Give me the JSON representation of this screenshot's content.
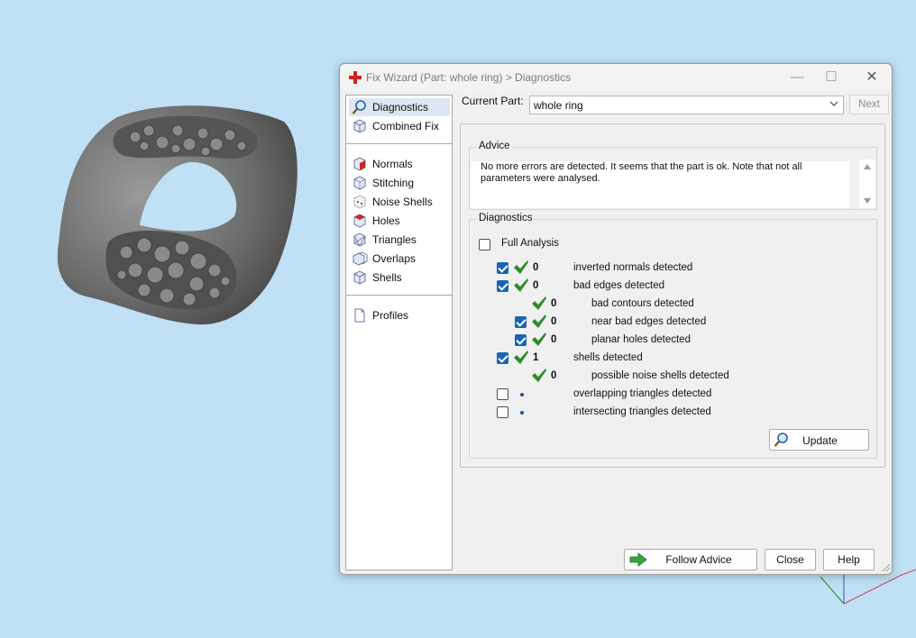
{
  "dialog": {
    "title": "Fix Wizard (Part: whole ring) > Diagnostics",
    "window_controls": {
      "minimize": "—",
      "maximize": "☐",
      "close": "✕"
    }
  },
  "sidebar": {
    "items": [
      {
        "label": "Diagnostics",
        "icon": "magnifier-icon",
        "selected": true
      },
      {
        "label": "Combined Fix",
        "icon": "cube-icon"
      },
      {
        "label": "Normals",
        "icon": "cube-normals-icon"
      },
      {
        "label": "Stitching",
        "icon": "cube-stitching-icon"
      },
      {
        "label": "Noise Shells",
        "icon": "cube-noise-icon"
      },
      {
        "label": "Holes",
        "icon": "cube-holes-icon"
      },
      {
        "label": "Triangles",
        "icon": "cube-triangles-icon"
      },
      {
        "label": "Overlaps",
        "icon": "cube-overlaps-icon"
      },
      {
        "label": "Shells",
        "icon": "cube-shells-icon"
      },
      {
        "label": "Profiles",
        "icon": "document-icon"
      }
    ]
  },
  "current_part": {
    "label": "Current Part:",
    "value": "whole ring",
    "next_label": "Next"
  },
  "advice": {
    "title": "Advice",
    "text": "No more errors are detected. It seems that the part is ok. Note that not all parameters were analysed."
  },
  "diagnostics": {
    "title": "Diagnostics",
    "full_analysis_label": "Full Analysis",
    "full_analysis_checked": false,
    "rows": [
      {
        "checkbox": true,
        "checked": true,
        "status": "ok",
        "count": "0",
        "label": "inverted normals detected",
        "indent": 0
      },
      {
        "checkbox": true,
        "checked": true,
        "status": "ok",
        "count": "0",
        "label": "bad edges detected",
        "indent": 0
      },
      {
        "checkbox": false,
        "checked": false,
        "status": "ok",
        "count": "0",
        "label": "bad contours detected",
        "indent": 1
      },
      {
        "checkbox": true,
        "checked": true,
        "status": "ok",
        "count": "0",
        "label": "near bad edges detected",
        "indent": 1
      },
      {
        "checkbox": true,
        "checked": true,
        "status": "ok",
        "count": "0",
        "label": "planar holes detected",
        "indent": 1
      },
      {
        "checkbox": true,
        "checked": true,
        "status": "ok",
        "count": "1",
        "label": "shells detected",
        "indent": 0
      },
      {
        "checkbox": false,
        "checked": false,
        "status": "ok",
        "count": "0",
        "label": "possible noise shells detected",
        "indent": 1
      },
      {
        "checkbox": true,
        "checked": false,
        "status": "pending",
        "count": "",
        "label": "overlapping triangles detected",
        "indent": 0
      },
      {
        "checkbox": true,
        "checked": false,
        "status": "pending",
        "count": "",
        "label": "intersecting triangles detected",
        "indent": 0
      }
    ],
    "update_label": "Update"
  },
  "buttons": {
    "follow_advice": "Follow Advice",
    "close": "Close",
    "help": "Help"
  },
  "colors": {
    "background": "#bfe0f5",
    "check_green": "#2e8b2e",
    "checkbox_blue": "#1a63b5",
    "title_icon_red": "#d62020",
    "arrow_green": "#3aa53a"
  }
}
